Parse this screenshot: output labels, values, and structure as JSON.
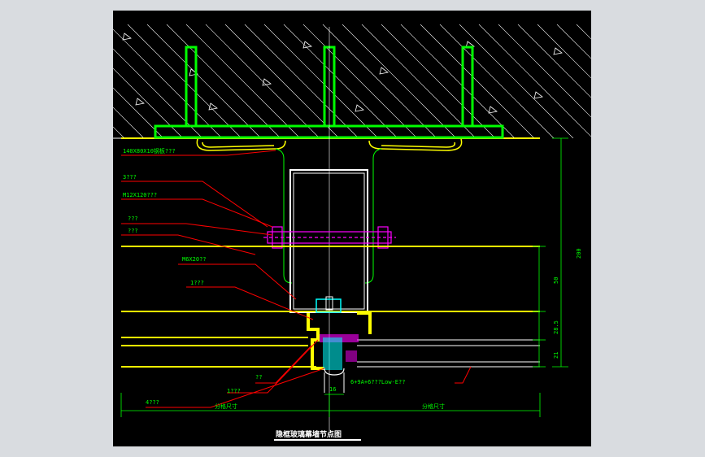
{
  "drawing": {
    "title": "隐框玻璃幕墙节点图",
    "labels": {
      "embed_plate": "140X80X10钢板???",
      "bolt_label": "3???",
      "bolt_size": "M12X120???",
      "washer": "???",
      "pad": "???",
      "screw": "M6X20??",
      "pressure_plate": "1???",
      "glass_spec": "6+9A+6???Low-E??",
      "seal": "??",
      "structural_glue": "1???",
      "foam_rod": "4???"
    },
    "dims": {
      "total": "200",
      "d1": "50",
      "d2": "28.5",
      "d3": "21",
      "joint": "16"
    },
    "bottom": {
      "left": "分格尺寸",
      "right": "分格尺寸"
    }
  },
  "colors": {
    "background": "#000000",
    "frame": "#d9dce0",
    "concrete": "#ffffff",
    "anchor": "#00ff00",
    "leader": "#ff0000",
    "glass": "#ffff00",
    "bolt": "#ff00ff",
    "dimension": "#00ff00",
    "sealant": "#00ffff"
  }
}
